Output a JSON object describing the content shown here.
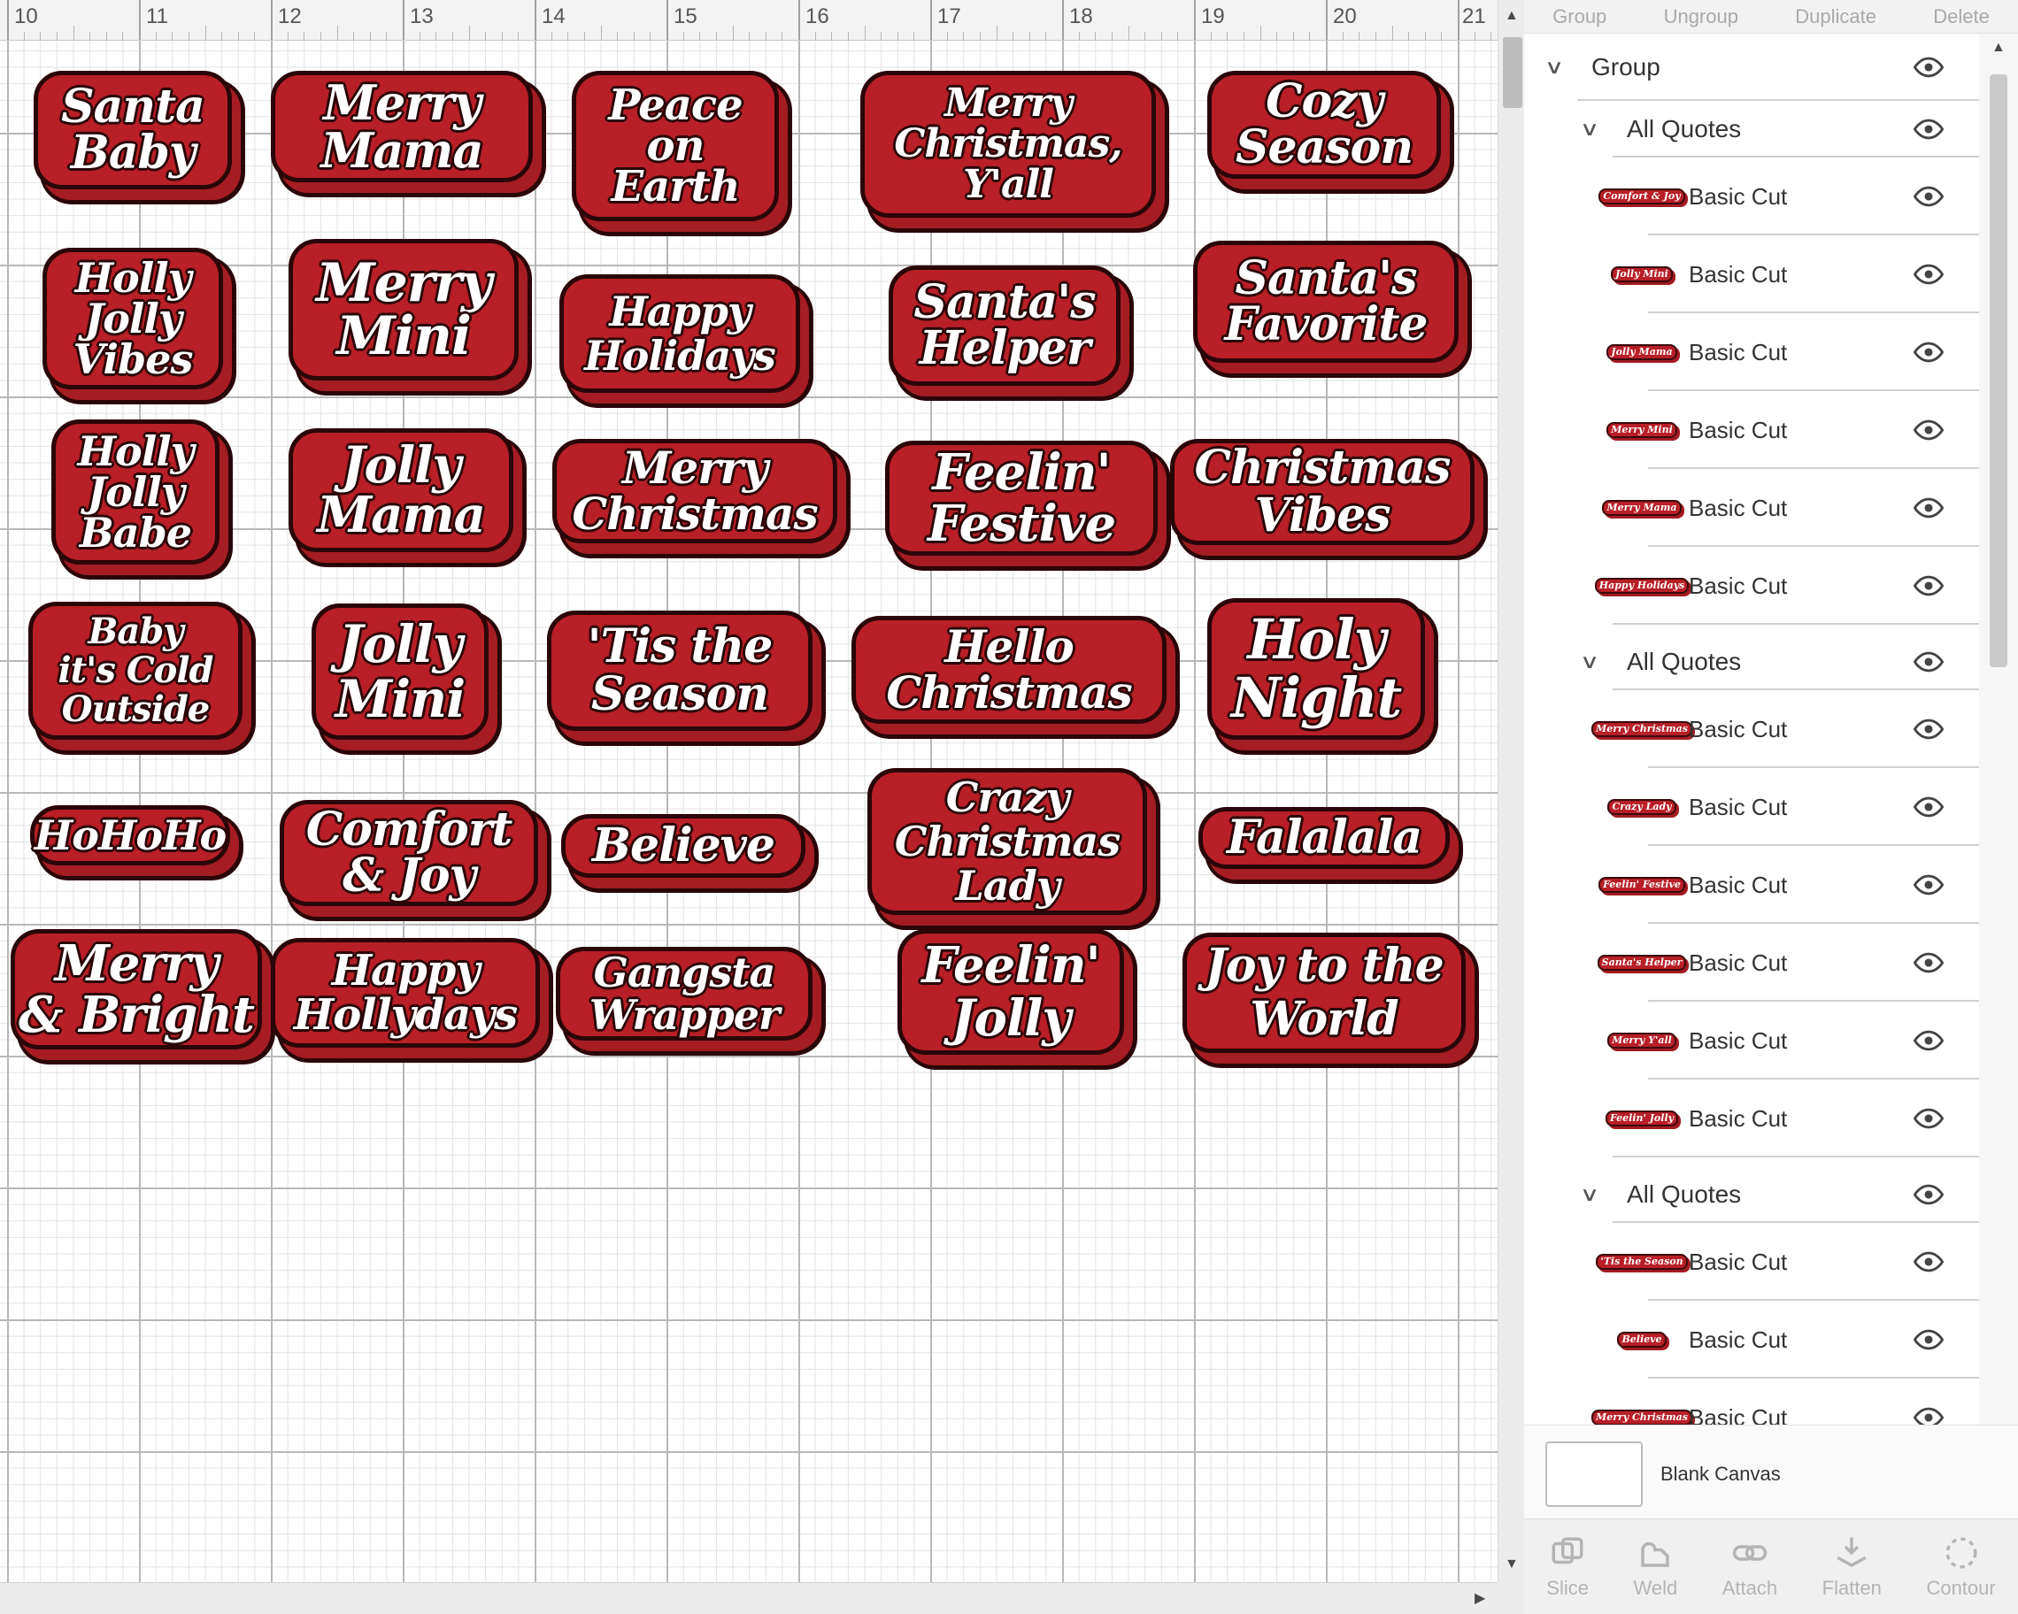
{
  "ruler": {
    "numbers": [
      "10",
      "11",
      "12",
      "13",
      "14",
      "15",
      "16",
      "17",
      "18",
      "19",
      "20",
      "21"
    ]
  },
  "quotes": [
    "Santa\nBaby",
    "Merry\nMama",
    "Peace\non\nEarth",
    "Merry\nChristmas,\nY'all",
    "Cozy\nSeason",
    "Holly\nJolly\nVibes",
    "Merry\nMini",
    "Happy\nHolidays",
    "Santa's\nHelper",
    "Santa's\nFavorite",
    "Holly\nJolly\nBabe",
    "Jolly\nMama",
    "Merry\nChristmas",
    "Feelin'\nFestive",
    "Christmas\nVibes",
    "Baby\nit's Cold\nOutside",
    "Jolly\nMini",
    "'Tis the\nSeason",
    "Hello\nChristmas",
    "Holy\nNight",
    "HoHoHo",
    "Comfort\n& Joy",
    "Believe",
    "Crazy\nChristmas\nLady",
    "Falalala",
    "Merry\n& Bright",
    "Happy\nHollydays",
    "Gangsta\nWrapper",
    "Feelin'\nJolly",
    "Joy to the\nWorld"
  ],
  "panel": {
    "toolbar_top": [
      "Group",
      "Ungroup",
      "Duplicate",
      "Delete"
    ],
    "group_label": "Group",
    "section_label": "All Quotes",
    "item_label": "Basic Cut",
    "thumbs_1": [
      "Comfort\n& Joy",
      "Jolly\nMini",
      "Jolly\nMama",
      "Merry\nMini",
      "Merry\nMama",
      "Happy\nHolidays"
    ],
    "thumbs_2": [
      "Merry\nChristmas",
      "Crazy\nLady",
      "Feelin'\nFestive",
      "Santa's\nHelper",
      "Merry\nY'all",
      "Feelin'\nJolly"
    ],
    "thumbs_3": [
      "'Tis the\nSeason",
      "Believe",
      "Merry\nChristmas"
    ],
    "blank_canvas": "Blank Canvas",
    "toolbar_bottom": [
      "Slice",
      "Weld",
      "Attach",
      "Flatten",
      "Contour"
    ]
  }
}
